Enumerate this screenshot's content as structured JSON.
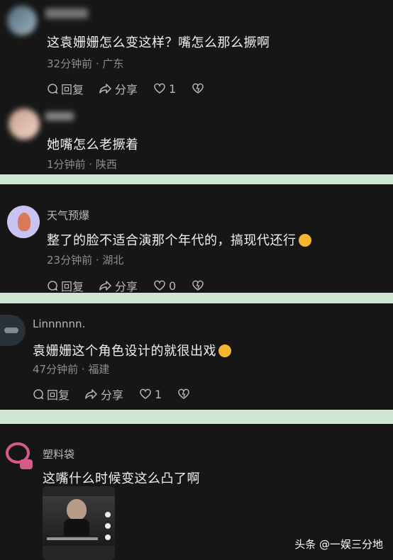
{
  "comments": [
    {
      "name": "",
      "text": "这袁姗姗怎么变这样？嘴怎么那么撅啊",
      "meta": "32分钟前 · 广东",
      "reply": "回复",
      "share": "分享",
      "likes": "1"
    },
    {
      "name": "",
      "text": "她嘴怎么老撅着",
      "meta": "1分钟前 · 陕西"
    },
    {
      "name": "天气预爆",
      "text": "整了的脸不适合演那个年代的，搞现代还行",
      "meta": "23分钟前 · 湖北",
      "reply": "回复",
      "share": "分享",
      "likes": "0"
    },
    {
      "name": "Linnnnnn.",
      "text": "袁姗姗这个角色设计的就很出戏",
      "meta": "47分钟前 · 福建",
      "reply": "回复",
      "share": "分享",
      "likes": "1"
    },
    {
      "name": "塑料袋",
      "text": "这嘴什么时候变这么凸了啊"
    }
  ],
  "watermark": "头条 @一娱三分地",
  "icons": [
    "comment-icon",
    "share-icon",
    "heart-icon",
    "dislike-heart-icon"
  ],
  "colors": {
    "panel": "#161616",
    "separator": "#cfe6d2",
    "emoji": "#f2b530"
  }
}
